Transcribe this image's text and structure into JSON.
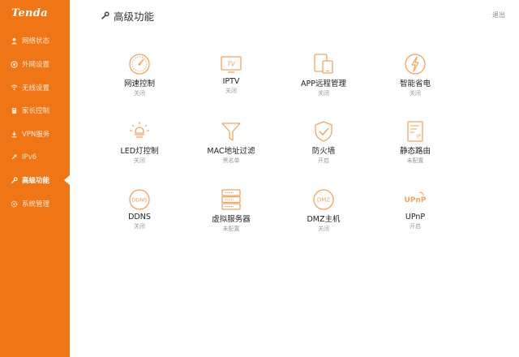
{
  "brand": {
    "logo": "Tenda",
    "accent": "#f07615",
    "icon_color": "#f5a35c"
  },
  "header": {
    "title": "高级功能",
    "logout": "退出"
  },
  "sidebar": {
    "items": [
      {
        "label": "网络状态",
        "icon": "status-icon"
      },
      {
        "label": "外网设置",
        "icon": "globe-icon"
      },
      {
        "label": "无线设置",
        "icon": "wifi-icon"
      },
      {
        "label": "家长控制",
        "icon": "parent-icon"
      },
      {
        "label": "VPN服务",
        "icon": "vpn-icon"
      },
      {
        "label": "IPv6",
        "icon": "ipv6-icon"
      },
      {
        "label": "高级功能",
        "icon": "wrench-icon",
        "active": true
      },
      {
        "label": "系统管理",
        "icon": "gear-icon"
      }
    ]
  },
  "features": [
    {
      "name": "网速控制",
      "status": "关闭",
      "icon": "speedometer-icon"
    },
    {
      "name": "IPTV",
      "status": "关闭",
      "icon": "tv-icon"
    },
    {
      "name": "APP远程管理",
      "status": "关闭",
      "icon": "devices-icon"
    },
    {
      "name": "智能省电",
      "status": "关闭",
      "icon": "power-save-icon"
    },
    {
      "name": "LED灯控制",
      "status": "关闭",
      "icon": "led-bulb-icon"
    },
    {
      "name": "MAC地址过滤",
      "status": "黑名单",
      "icon": "filter-icon"
    },
    {
      "name": "防火墙",
      "status": "开启",
      "icon": "shield-icon"
    },
    {
      "name": "静态路由",
      "status": "未配置",
      "icon": "route-doc-icon"
    },
    {
      "name": "DDNS",
      "status": "关闭",
      "icon": "ddns-icon"
    },
    {
      "name": "虚拟服务器",
      "status": "未配置",
      "icon": "server-icon"
    },
    {
      "name": "DMZ主机",
      "status": "关闭",
      "icon": "dmz-icon"
    },
    {
      "name": "UPnP",
      "status": "开启",
      "icon": "upnp-icon"
    }
  ]
}
